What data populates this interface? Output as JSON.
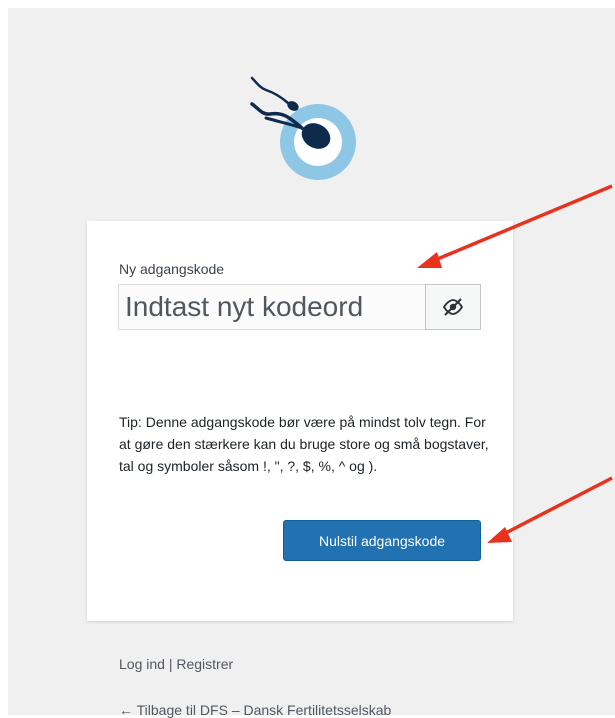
{
  "form": {
    "label": "Ny adgangskode",
    "password_placeholder": "Indtast nyt kodeord",
    "tip": "Tip: Denne adgangskode bør være på mindst tolv tegn. For at gøre den stærkere kan du bruge store og små bogstaver, tal og symboler såsom !, \", ?, $, %, ^ og ).",
    "submit_label": "Nulstil adgangskode"
  },
  "icons": {
    "logo": "sperm-logo-icon",
    "toggle": "eye-slash-icon"
  },
  "nav": {
    "login": "Log ind",
    "separator": " | ",
    "register": "Registrer",
    "back": "← Tilbage til DFS – Dansk Fertilitetsselskab"
  },
  "colors": {
    "background": "#f0f0f1",
    "primary_button": "#2271b1",
    "logo_dark": "#0e2a4d",
    "logo_light": "#8ec6e6",
    "annotation_arrow": "#e8321e"
  }
}
